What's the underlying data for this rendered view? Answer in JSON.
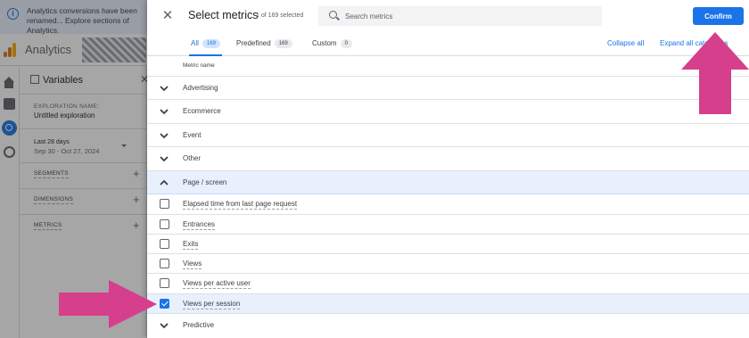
{
  "background_app": {
    "banner_text": "Analytics conversions have been renamed... Explore sections of Analytics.",
    "app_title": "Analytics",
    "variables_title": "Variables",
    "exploration_label": "EXPLORATION NAME:",
    "exploration_name": "Untitled exploration",
    "date_range_label": "Last 28 days",
    "date_range_value": "Sep 30 - Oct 27, 2024",
    "sections": [
      "SEGMENTS",
      "DIMENSIONS",
      "METRICS"
    ]
  },
  "dialog": {
    "title": "Select metrics",
    "selected_count": "1 of 169 selected",
    "search_placeholder": "Search metrics",
    "confirm_label": "Confirm",
    "tabs": [
      {
        "label": "All",
        "count": "169"
      },
      {
        "label": "Predefined",
        "count": "169"
      },
      {
        "label": "Custom",
        "count": "0"
      }
    ],
    "collapse_all": "Collapse all",
    "expand_all": "Expand all categories",
    "column_header": "Metric name",
    "categories_before": [
      "Advertising",
      "Ecommerce",
      "Event",
      "Other"
    ],
    "open_category": "Page / screen",
    "metrics": [
      {
        "label": "Elapsed time from last page request",
        "checked": false
      },
      {
        "label": "Entrances",
        "checked": false
      },
      {
        "label": "Exits",
        "checked": false
      },
      {
        "label": "Views",
        "checked": false
      },
      {
        "label": "Views per active user",
        "checked": false
      },
      {
        "label": "Views per session",
        "checked": true
      }
    ],
    "categories_after": [
      "Predictive"
    ]
  },
  "annotations": {
    "arrow_color": "#d63f8c",
    "accent_color": "#1a73e8"
  }
}
